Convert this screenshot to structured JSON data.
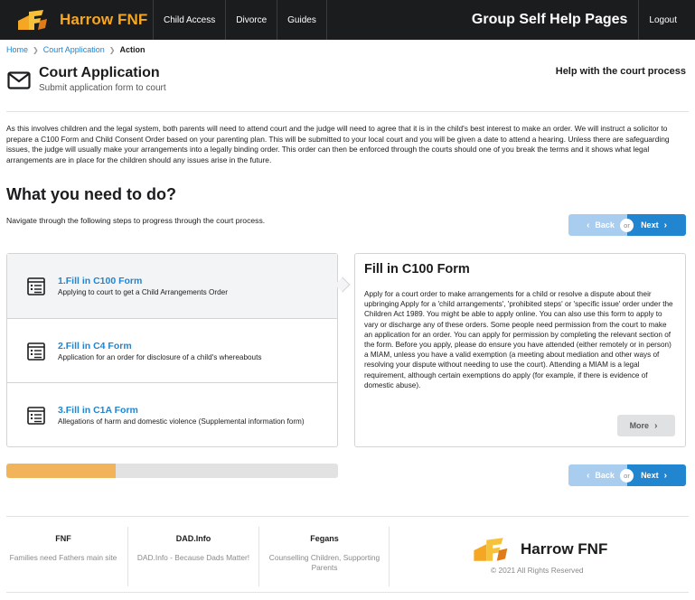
{
  "header": {
    "brand": "Harrow FNF",
    "nav": [
      "Child Access",
      "Divorce",
      "Guides"
    ],
    "right_title": "Group Self Help Pages",
    "logout": "Logout"
  },
  "breadcrumb": {
    "items": [
      "Home",
      "Court Application"
    ],
    "active": "Action"
  },
  "page": {
    "title": "Court Application",
    "subtitle": "Submit application form to court",
    "help_link": "Help with the court process"
  },
  "intro": "As this involves children and the legal system, both parents will need to attend court and the judge will need to agree that it is in the child's best interest to make an order. We will instruct a solicitor to prepare a C100 Form and Child Consent Order based on your parenting plan. This will be submitted to your local court and you will be given a date to attend a hearing. Unless there are safeguarding issues, the judge will usually make your arrangements into a legally binding order. This order can then be enforced through the courts should one of you break the terms and it shows what legal arrangements are in place for the children should any issues arise in the future.",
  "section": {
    "title": "What you need to do?",
    "subtitle": "Navigate through the following steps to progress through the court process."
  },
  "nav_buttons": {
    "back": "Back",
    "or": "or",
    "next": "Next"
  },
  "steps": [
    {
      "title": "1.Fill in C100 Form",
      "desc": "Applying to court to get a Child Arrangements Order",
      "active": true
    },
    {
      "title": "2.Fill in C4 Form",
      "desc": "Application for an order for disclosure of a child's whereabouts",
      "active": false
    },
    {
      "title": "3.Fill in C1A Form",
      "desc": "Allegations of harm and domestic violence (Supplemental information form)",
      "active": false
    }
  ],
  "detail": {
    "title": "Fill in C100 Form",
    "body": "Apply for a court order to make arrangements for a child or resolve a dispute about their upbringing Apply for a 'child arrangements', 'prohibited steps' or 'specific issue' order under the Children Act 1989. You might be able to apply online. You can also use this form to apply to vary or discharge any of these orders. Some people need permission from the court to make an application for an order. You can apply for permission by completing the relevant section of the form. Before you apply, please do ensure you have attended (either remotely or in person) a MIAM, unless you have a valid exemption (a meeting about mediation and other ways of resolving your dispute without needing to use the court). Attending a MIAM is a legal requirement, although certain exemptions do apply (for example, if there is evidence of domestic abuse).",
    "more": "More"
  },
  "progress": {
    "value": 0.33
  },
  "footer": {
    "columns": [
      {
        "title": "FNF",
        "desc": "Families need Fathers main site"
      },
      {
        "title": "DAD.Info",
        "desc": "DAD.Info - Because Dads Matter!"
      },
      {
        "title": "Fegans",
        "desc": "Counselling Children, Supporting Parents"
      }
    ],
    "brand": "Harrow FNF",
    "copyright": "© 2021 All Rights Reserved"
  },
  "colors": {
    "accent": "#2185d0",
    "brand": "#f5a623",
    "progress": "#f2b45a",
    "topbar": "#1b1c1d"
  },
  "icons": {
    "logo": "fnf-logo-icon",
    "mail": "envelope-icon",
    "form": "form-list-icon",
    "chevron_left": "chevron-left-icon",
    "chevron_right": "chevron-right-icon"
  }
}
